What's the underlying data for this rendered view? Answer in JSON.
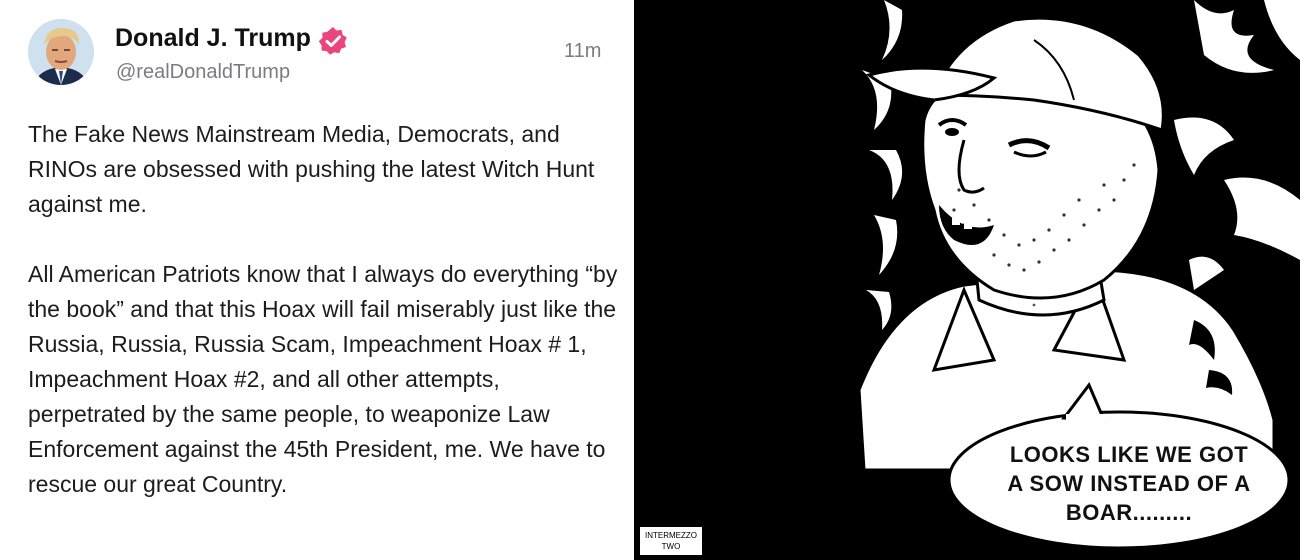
{
  "post": {
    "display_name": "Donald J. Trump",
    "handle": "@realDonaldTrump",
    "timestamp": "11m",
    "paragraphs": [
      "The Fake News Mainstream Media, Democrats, and RINOs are obsessed with pushing the latest Witch Hunt against me.",
      "All American Patriots know that I always do everything “by the book” and that this Hoax will fail miserably just like the Russia, Russia, Russia Scam, Impeachment Hoax # 1, Impeachment Hoax #2, and all other attempts, perpetrated by the same people, to weaponize Law Enforcement against the 45th President, me. We have to rescue our great Country."
    ],
    "verified_badge_color": "#e8467c"
  },
  "comic": {
    "speech_bubble": "LOOKS LIKE WE GOT\nA SOW INSTEAD OF A\nBOAR.........",
    "credit": "INTERMEZZO\nTWO"
  },
  "icons": {
    "avatar": "avatar-photo",
    "verified": "verified-badge-icon"
  }
}
